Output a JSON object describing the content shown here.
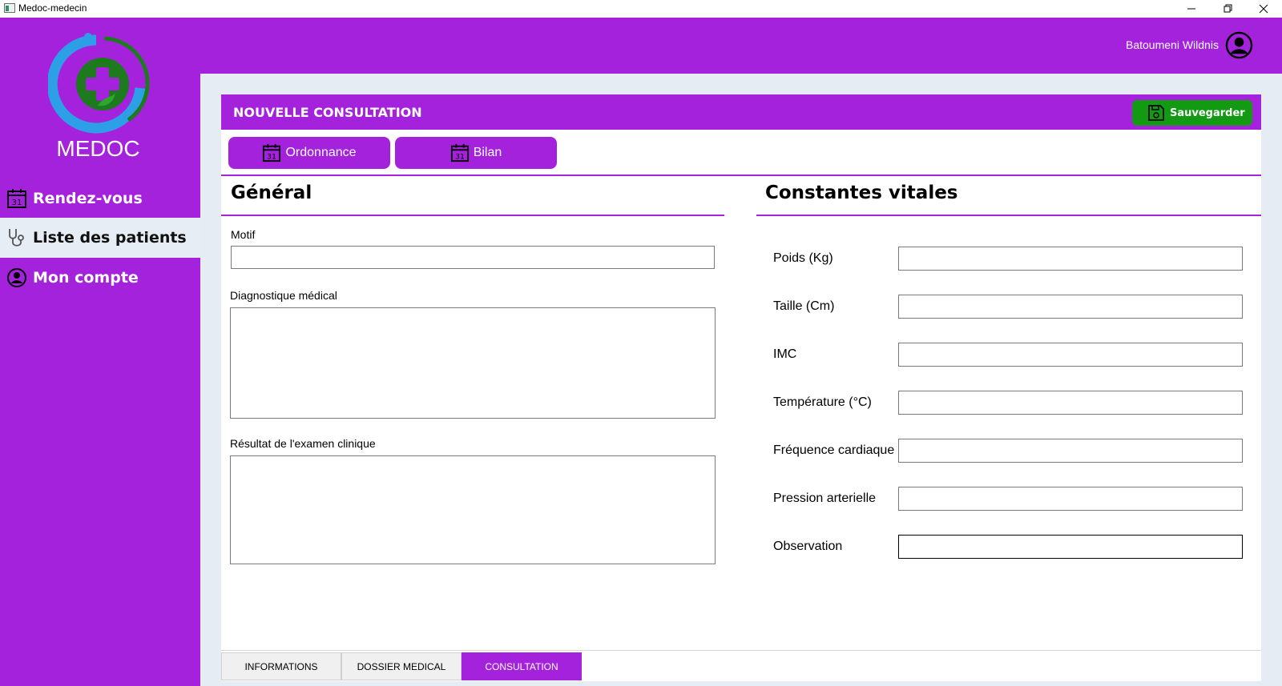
{
  "window": {
    "title": "Medoc-medecin"
  },
  "header": {
    "username": "Batoumeni Wildnis"
  },
  "sidebar": {
    "brand": "MEDOC",
    "items": [
      {
        "label": "Rendez-vous",
        "icon": "calendar-icon",
        "active": false
      },
      {
        "label": "Liste des patients",
        "icon": "stethoscope-icon",
        "active": true
      },
      {
        "label": "Mon compte",
        "icon": "user-circle-icon",
        "active": false
      }
    ]
  },
  "panel": {
    "title": "NOUVELLE CONSULTATION",
    "save_label": "Sauvegarder",
    "actions": [
      {
        "label": "Ordonnance",
        "icon": "calendar-icon"
      },
      {
        "label": "Bilan",
        "icon": "calendar-icon"
      }
    ]
  },
  "general": {
    "title": "Général",
    "motif_label": "Motif",
    "motif_value": "",
    "diagnostic_label": "Diagnostique médical",
    "diagnostic_value": "",
    "examen_label": "Résultat de l'examen clinique",
    "examen_value": ""
  },
  "vitals": {
    "title": "Constantes vitales",
    "fields": [
      {
        "label": "Poids (Kg)",
        "value": ""
      },
      {
        "label": "Taille (Cm)",
        "value": ""
      },
      {
        "label": "IMC",
        "value": ""
      },
      {
        "label": "Température (°C)",
        "value": ""
      },
      {
        "label": "Fréquence cardiaque",
        "value": ""
      },
      {
        "label": "Pression arterielle",
        "value": ""
      },
      {
        "label": "Observation",
        "value": ""
      }
    ]
  },
  "tabs": [
    {
      "label": "INFORMATIONS",
      "active": false
    },
    {
      "label": "DOSSIER MEDICAL",
      "active": false
    },
    {
      "label": "CONSULTATION",
      "active": true
    }
  ],
  "colors": {
    "accent": "#a522dd",
    "save": "#129a12",
    "content_bg": "#e6ecf3"
  }
}
